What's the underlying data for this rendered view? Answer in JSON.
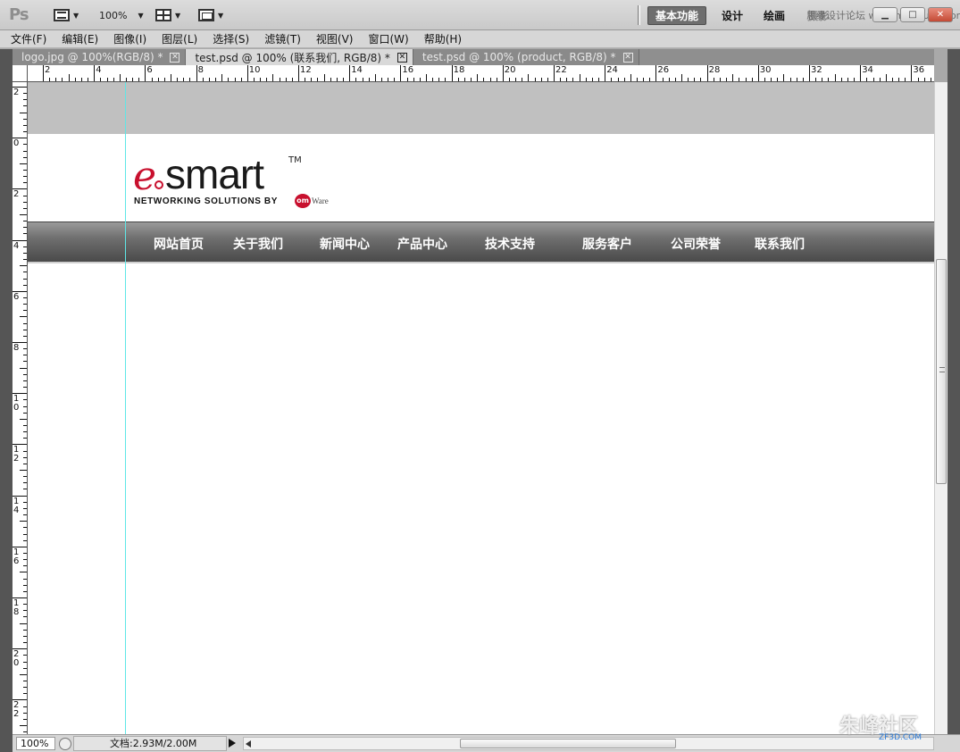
{
  "app": {
    "logo": "Ps",
    "zoom": "100%",
    "workspaces": [
      "基本功能",
      "设计",
      "绘画",
      "摄影"
    ],
    "active_workspace": "基本功能",
    "watermark_top": "思缘设计论坛 www.missyuan.com"
  },
  "menu": [
    "文件(F)",
    "编辑(E)",
    "图像(I)",
    "图层(L)",
    "选择(S)",
    "滤镜(T)",
    "视图(V)",
    "窗口(W)",
    "帮助(H)"
  ],
  "tabs": [
    {
      "label": "logo.jpg @ 100%(RGB/8) *",
      "active": false
    },
    {
      "label": "test.psd @ 100% (联系我们, RGB/8) *",
      "active": true
    },
    {
      "label": "test.psd @ 100% (product, RGB/8) *",
      "active": false
    }
  ],
  "ruler_top_labels": [
    "2",
    "4",
    "6",
    "8",
    "10",
    "12",
    "14",
    "16",
    "18",
    "20",
    "22",
    "24",
    "26",
    "28",
    "30",
    "32",
    "34",
    "36"
  ],
  "ruler_left_labels": [
    "2",
    "0",
    "2",
    "4",
    "6",
    "8",
    "10",
    "12",
    "14",
    "16",
    "18",
    "20",
    "22"
  ],
  "canvas": {
    "logo": {
      "e": "e",
      "word": "smart",
      "tm": "TM",
      "tagline": "NETWORKING SOLUTIONS BY",
      "badge": "om",
      "ware": "Ware"
    },
    "nav": [
      "网站首页",
      "关于我们",
      "新闻中心",
      "产品中心",
      "技术支持",
      "服务客户",
      "公司荣誉",
      "联系我们"
    ]
  },
  "status": {
    "zoom": "100%",
    "doc": "文档:2.93M/2.00M"
  },
  "watermark_br": "朱峰社区",
  "watermark_br_sub": "ZF3D.COM"
}
